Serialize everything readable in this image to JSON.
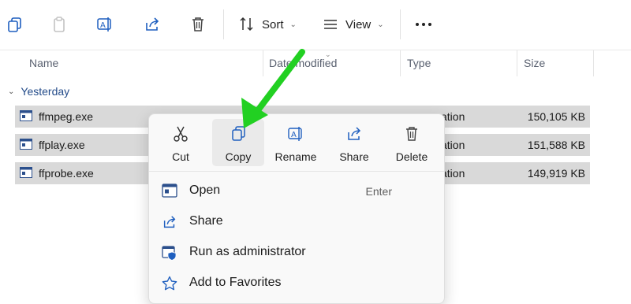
{
  "toolbar": {
    "sort_label": "Sort",
    "view_label": "View"
  },
  "columns": {
    "name": "Name",
    "date_modified": "Date modified",
    "type": "Type",
    "size": "Size"
  },
  "group": {
    "label": "Yesterday"
  },
  "files": [
    {
      "name": "ffmpeg.exe",
      "type": "ation",
      "size": "150,105 KB"
    },
    {
      "name": "ffplay.exe",
      "type": "ation",
      "size": "151,588 KB"
    },
    {
      "name": "ffprobe.exe",
      "type": "ation",
      "size": "149,919 KB"
    }
  ],
  "context_menu": {
    "quick_actions": [
      {
        "label": "Cut",
        "icon": "scissors-icon"
      },
      {
        "label": "Copy",
        "icon": "copy-icon"
      },
      {
        "label": "Rename",
        "icon": "rename-icon"
      },
      {
        "label": "Share",
        "icon": "share-icon"
      },
      {
        "label": "Delete",
        "icon": "trash-icon"
      }
    ],
    "items": [
      {
        "label": "Open",
        "shortcut": "Enter",
        "icon": "app-window-icon"
      },
      {
        "label": "Share",
        "shortcut": "",
        "icon": "share-icon"
      },
      {
        "label": "Run as administrator",
        "shortcut": "",
        "icon": "shield-app-icon"
      },
      {
        "label": "Add to Favorites",
        "shortcut": "",
        "icon": "star-icon"
      }
    ]
  },
  "colors": {
    "accent": "#1f5fbf",
    "row_selected": "#d9d9d9",
    "menu_bg": "#f9f9f9",
    "arrow_green": "#22d022"
  }
}
